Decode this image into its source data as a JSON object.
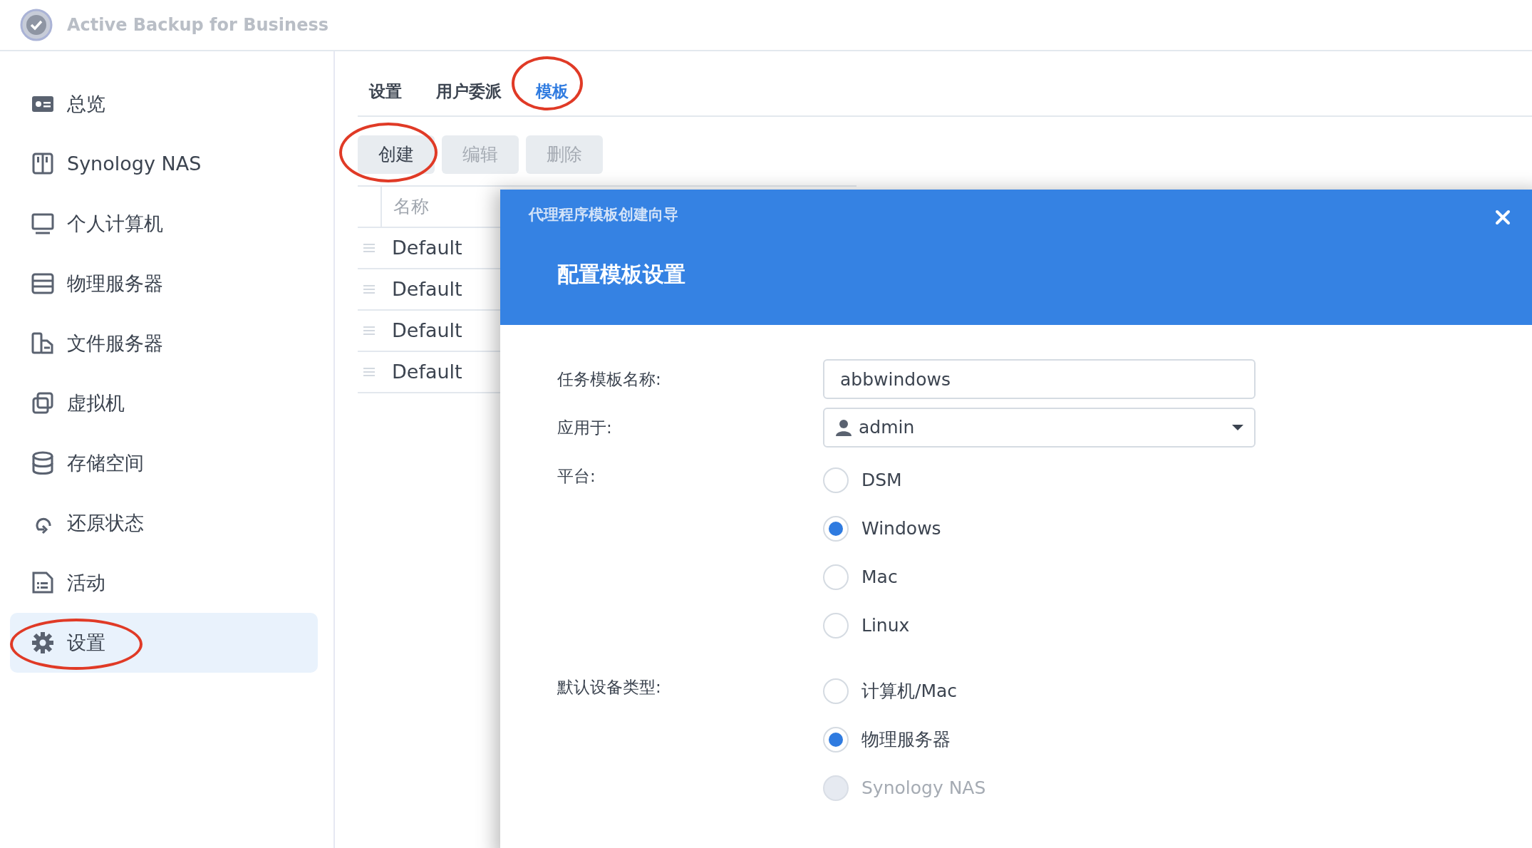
{
  "app": {
    "title": "Active Backup for Business"
  },
  "sidebar": {
    "items": [
      {
        "label": "总览",
        "selected": false,
        "circled": false
      },
      {
        "label": "Synology NAS",
        "selected": false,
        "circled": false
      },
      {
        "label": "个人计算机",
        "selected": false,
        "circled": false
      },
      {
        "label": "物理服务器",
        "selected": false,
        "circled": false
      },
      {
        "label": "文件服务器",
        "selected": false,
        "circled": false
      },
      {
        "label": "虚拟机",
        "selected": false,
        "circled": false
      },
      {
        "label": "存储空间",
        "selected": false,
        "circled": false
      },
      {
        "label": "还原状态",
        "selected": false,
        "circled": false
      },
      {
        "label": "活动",
        "selected": false,
        "circled": false
      },
      {
        "label": "设置",
        "selected": true,
        "circled": true
      }
    ]
  },
  "tabs": [
    {
      "label": "设置",
      "selected": false,
      "circled": false
    },
    {
      "label": "用户委派",
      "selected": false,
      "circled": false
    },
    {
      "label": "模板",
      "selected": true,
      "circled": true
    }
  ],
  "toolbar": {
    "buttons": [
      {
        "label": "创建",
        "disabled": false,
        "circled": true
      },
      {
        "label": "编辑",
        "disabled": true,
        "circled": false
      },
      {
        "label": "删除",
        "disabled": true,
        "circled": false
      }
    ]
  },
  "table": {
    "columns": [
      "名称"
    ],
    "rows": [
      [
        "Default"
      ],
      [
        "Default"
      ],
      [
        "Default"
      ],
      [
        "Default"
      ]
    ]
  },
  "dialog": {
    "title": "代理程序模板创建向导",
    "heading": "配置模板设置",
    "fields": [
      {
        "kind": "text",
        "label": "任务模板名称:",
        "value": "abbwindows"
      },
      {
        "kind": "select",
        "label": "应用于:",
        "value": "admin"
      },
      {
        "kind": "radio",
        "label": "平台:",
        "options": [
          {
            "label": "DSM",
            "selected": false,
            "disabled": false
          },
          {
            "label": "Windows",
            "selected": true,
            "disabled": false
          },
          {
            "label": "Mac",
            "selected": false,
            "disabled": false
          },
          {
            "label": "Linux",
            "selected": false,
            "disabled": false
          }
        ]
      },
      {
        "kind": "radio",
        "label": "默认设备类型:",
        "options": [
          {
            "label": "计算机/Mac",
            "selected": false,
            "disabled": false
          },
          {
            "label": "物理服务器",
            "selected": true,
            "disabled": false
          },
          {
            "label": "Synology NAS",
            "selected": false,
            "disabled": true
          }
        ]
      }
    ]
  }
}
